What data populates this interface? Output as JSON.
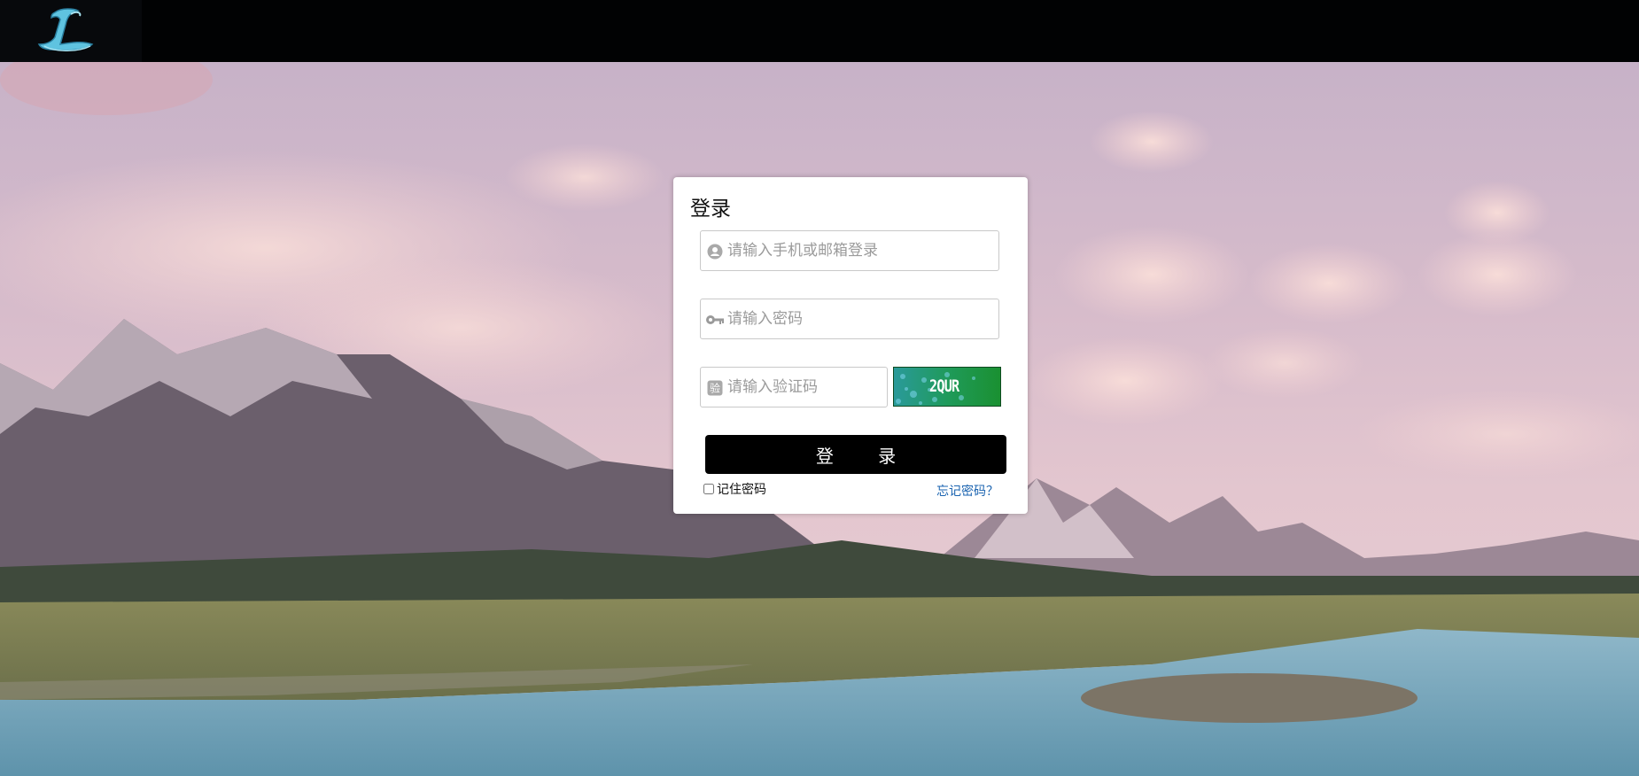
{
  "header": {
    "logo_icon": "stylized-letter-l-logo-icon",
    "logo_color": "#5fc3e0"
  },
  "login": {
    "title": "登录",
    "username": {
      "placeholder": "请输入手机或邮箱登录",
      "value": "",
      "icon": "user-circle-icon"
    },
    "password": {
      "placeholder": "请输入密码",
      "value": "",
      "icon": "key-icon"
    },
    "captcha_input": {
      "placeholder": "请输入验证码",
      "value": "",
      "icon": "verification-badge-icon",
      "icon_text": "验"
    },
    "captcha_image_text": "2QUR",
    "submit_label": "登 录",
    "remember_label": "记住密码",
    "remember_checked": false,
    "forgot_label": "忘记密码？",
    "button_color": "#000000",
    "link_color": "#1a63b0"
  }
}
